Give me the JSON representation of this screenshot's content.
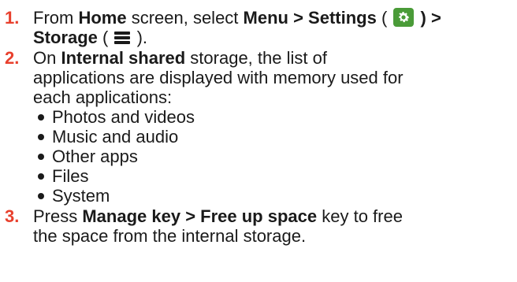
{
  "steps": [
    {
      "number": "1.",
      "parts": {
        "a": "From ",
        "b": "Home",
        "c": " screen, select ",
        "d": "Menu > Settings",
        "e": " ( ",
        "f": " ) >",
        "g": "Storage",
        "h": " ( ",
        "i": " )."
      }
    },
    {
      "number": "2.",
      "parts": {
        "a": "On ",
        "b": "Internal shared",
        "c": " storage, the list of",
        "line2": "applications are displayed with memory used for",
        "line3": "each applications:"
      },
      "bullets": [
        "Photos and videos",
        "Music and audio",
        "Other apps",
        "Files",
        "System"
      ]
    },
    {
      "number": "3.",
      "parts": {
        "a": "Press ",
        "b": "Manage key > Free up space",
        "c": " key to free",
        "line2": "the space from the internal storage."
      }
    }
  ],
  "icons": {
    "settings": "settings-gear-icon",
    "storage": "storage-list-icon"
  },
  "colors": {
    "step_number": "#e8402d",
    "settings_icon_bg": "#4a9b38",
    "text": "#1a1a1a"
  }
}
